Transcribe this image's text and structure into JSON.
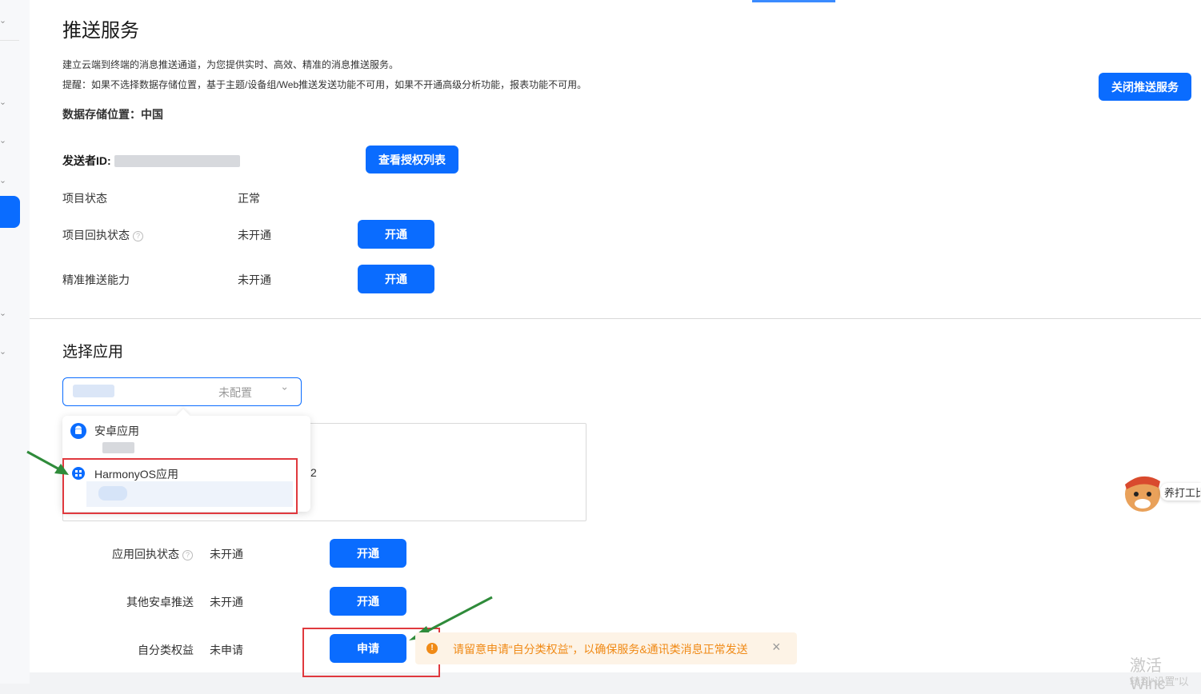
{
  "page": {
    "title": "推送服务",
    "desc1": "建立云端到终端的消息推送通道，为您提供实时、高效、精准的消息推送服务。",
    "desc2": "提醒：如果不选择数据存储位置，基于主题/设备组/Web推送发送功能不可用，如果不开通高级分析功能，报表功能不可用。",
    "storage": "数据存储位置：中国",
    "close_button": "关闭推送服务"
  },
  "sender": {
    "label": "发送者ID:",
    "button": "查看授权列表"
  },
  "project_rows": [
    {
      "label": "项目状态",
      "value": "正常"
    },
    {
      "label": "项目回执状态",
      "value": "未开通",
      "button": "开通"
    },
    {
      "label": "精准推送能力",
      "value": "未开通",
      "button": "开通"
    }
  ],
  "app_section": {
    "title": "选择应用",
    "select_status": "未配置",
    "dropdown": [
      {
        "label": "安卓应用"
      },
      {
        "label": "HarmonyOS应用"
      }
    ],
    "card_fragment": "2"
  },
  "app_rows": [
    {
      "label": "应用回执状态",
      "value": "未开通",
      "button": "开通"
    },
    {
      "label": "其他安卓推送",
      "value": "未开通",
      "button": "开通"
    },
    {
      "label": "自分类权益",
      "value": "未申请",
      "button": "申请"
    }
  ],
  "warning": {
    "text": "请留意申请“自分类权益”，以确保服务&通讯类消息正常发送",
    "close": "×",
    "icon": "!"
  },
  "mascot_text": "养打工比",
  "watermark": {
    "line1": "激活 Winc",
    "line2": "转到“设置”以"
  },
  "colors": {
    "primary": "#0a6cff",
    "highlight": "#e0393e",
    "arrow": "#2f8b3a",
    "warning_text": "#f08a16"
  }
}
